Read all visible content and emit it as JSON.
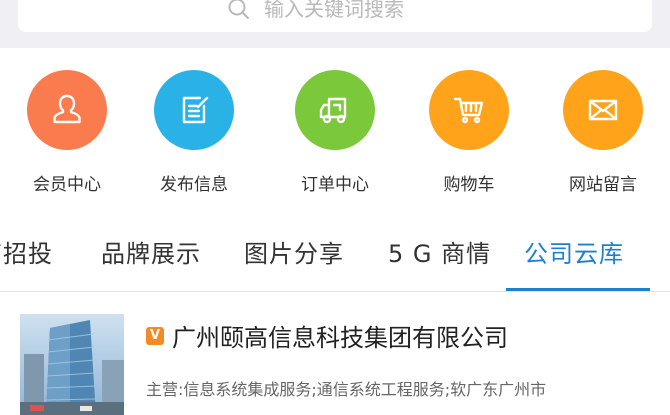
{
  "search": {
    "placeholder": "输入关键词搜索",
    "icon": "search-icon"
  },
  "quick_links": [
    {
      "label": "会员中心",
      "icon": "user-icon",
      "color": "#f97b4e"
    },
    {
      "label": "发布信息",
      "icon": "edit-icon",
      "color": "#2ab2e6"
    },
    {
      "label": "订单中心",
      "icon": "truck-icon",
      "color": "#7bc83a"
    },
    {
      "label": "购物车",
      "icon": "cart-icon",
      "color": "#ffa31a"
    },
    {
      "label": "网站留言",
      "icon": "mail-icon",
      "color": "#ffa31a"
    }
  ],
  "tabs": [
    {
      "label": "商招投"
    },
    {
      "label": "品牌展示"
    },
    {
      "label": "图片分享"
    },
    {
      "label": "5 G 商情"
    },
    {
      "label": "公司云库",
      "active": true
    }
  ],
  "company": {
    "badge": "V",
    "name": "广州颐高信息科技集团有限公司",
    "description": "主营:信息系统集成服务;通信系统工程服务;软广东广州市"
  },
  "colors": {
    "accent": "#1e80d0",
    "badge": "#f28a26"
  }
}
